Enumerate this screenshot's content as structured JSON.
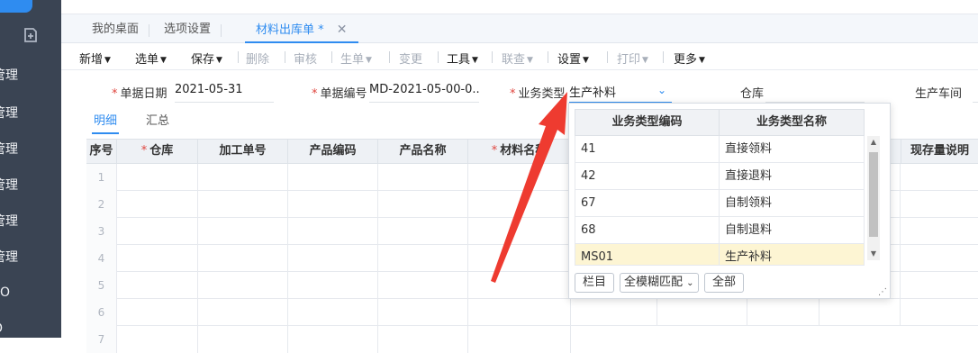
{
  "sidebar": {
    "items": [
      {
        "label": "管理"
      },
      {
        "label": "管理"
      },
      {
        "label": "管理"
      },
      {
        "label": "管理"
      },
      {
        "label": "管理"
      },
      {
        "label": "管理"
      },
      {
        "label": "FO"
      },
      {
        "label": "O"
      }
    ]
  },
  "tabs": [
    {
      "label": "我的桌面"
    },
    {
      "label": "选项设置"
    },
    {
      "label": "材料出库单",
      "required_mark": "*"
    }
  ],
  "toolbar": {
    "new": "新增",
    "select": "选单",
    "save": "保存",
    "delete": "删除",
    "audit": "审核",
    "generate": "生单",
    "change": "变更",
    "tools": "工具",
    "linked": "联查",
    "settings": "设置",
    "print": "打印",
    "more": "更多"
  },
  "form": {
    "date_label": "单据日期",
    "date_value": "2021-05-31",
    "code_label": "单据编号",
    "code_value": "MD-2021-05-00-0...",
    "biztype_label": "业务类型",
    "biztype_value": "生产补料",
    "warehouse_label": "仓库",
    "workshop_label": "生产车间"
  },
  "subtabs": {
    "detail": "明细",
    "summary": "汇总"
  },
  "grid": {
    "columns": [
      "序号",
      "仓库",
      "加工单号",
      "产品编码",
      "产品名称",
      "材料名称",
      "现存量说明"
    ],
    "row_numbers": [
      "1",
      "2",
      "3",
      "4",
      "5",
      "6",
      "7"
    ]
  },
  "dropdown": {
    "col_code": "业务类型编码",
    "col_name": "业务类型名称",
    "rows": [
      {
        "code": "41",
        "name": "直接领料"
      },
      {
        "code": "42",
        "name": "直接退料"
      },
      {
        "code": "67",
        "name": "自制领料"
      },
      {
        "code": "68",
        "name": "自制退料"
      },
      {
        "code": "MS01",
        "name": "生产补料"
      }
    ],
    "btn_columns": "栏目",
    "match_mode": "全模糊匹配",
    "btn_all": "全部"
  },
  "colors": {
    "accent": "#2f8cf0",
    "required": "#e0463f",
    "sidebar": "#3a4453",
    "annotation": "#ee3b30",
    "selected_row": "#fdf5d3"
  }
}
